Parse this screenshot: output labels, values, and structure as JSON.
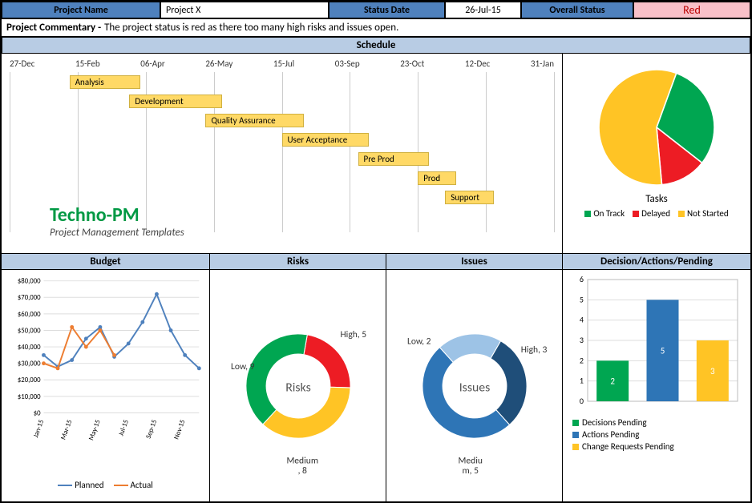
{
  "header": {
    "project_name_label": "Project Name",
    "project_name_value": "Project X",
    "status_date_label": "Status Date",
    "status_date_value": "26-Jul-15",
    "overall_status_label": "Overall Status",
    "overall_status_value": "Red"
  },
  "commentary": {
    "label": "Project Commentary -",
    "text": "The project status is red as there too many high risks and issues open."
  },
  "schedule": {
    "title": "Schedule",
    "axis": [
      "27-Dec",
      "15-Feb",
      "06-Apr",
      "26-May",
      "15-Jul",
      "03-Sep",
      "23-Oct",
      "12-Dec",
      "31-Jan"
    ],
    "bars": [
      {
        "label": "Analysis",
        "left_pct": 11,
        "width_pct": 13,
        "row": 0
      },
      {
        "label": "Development",
        "left_pct": 22,
        "width_pct": 17,
        "row": 1
      },
      {
        "label": "Quality Assurance",
        "left_pct": 36,
        "width_pct": 18,
        "row": 2
      },
      {
        "label": "User Acceptance",
        "left_pct": 50,
        "width_pct": 16,
        "row": 3
      },
      {
        "label": "Pre Prod",
        "left_pct": 64,
        "width_pct": 13,
        "row": 4
      },
      {
        "label": "Prod",
        "left_pct": 75,
        "width_pct": 7,
        "row": 5
      },
      {
        "label": "Support",
        "left_pct": 80,
        "width_pct": 9,
        "row": 6
      }
    ],
    "watermark": {
      "line1": "Techno-PM",
      "line2": "Project Management Templates"
    }
  },
  "tasks_pie": {
    "title": "Tasks",
    "legend": [
      "On Track",
      "Delayed",
      "Not Started"
    ]
  },
  "panels": {
    "budget": "Budget",
    "risks": "Risks",
    "issues": "Issues",
    "dap": "Decision/Actions/Pending"
  },
  "budget_legend": {
    "planned": "Planned",
    "actual": "Actual"
  },
  "risks_labels": {
    "center": "Risks",
    "high": "High, 5",
    "medium": "Medium , 8",
    "low": "Low, 9"
  },
  "issues_labels": {
    "center": "Issues",
    "high": "High, 3",
    "medium": "Medium, 5",
    "low": "Low, 2"
  },
  "dap_legend": {
    "decisions": "Decisions Pending",
    "actions": "Actions Pending",
    "change": "Change Requests Pending"
  },
  "chart_data": [
    {
      "type": "pie",
      "title": "Tasks",
      "series": [
        {
          "name": "On Track",
          "value": 30,
          "color": "#00a651"
        },
        {
          "name": "Delayed",
          "value": 13,
          "color": "#ed1c24"
        },
        {
          "name": "Not Started",
          "value": 57,
          "color": "#ffc425"
        }
      ]
    },
    {
      "type": "line",
      "title": "Budget",
      "ylabel": "",
      "xlabel": "",
      "ylim": [
        0,
        80000
      ],
      "yticks": [
        "$0",
        "$10,000",
        "$20,000",
        "$30,000",
        "$40,000",
        "$50,000",
        "$60,000",
        "$70,000",
        "$80,000"
      ],
      "categories": [
        "Jan-15",
        "Feb-15",
        "Mar-15",
        "Apr-15",
        "May-15",
        "Jun-15",
        "Jul-15",
        "Aug-15",
        "Sep-15",
        "Oct-15",
        "Nov-15",
        "Dec-15"
      ],
      "xtick_labels": [
        "Jan-15",
        "Mar-15",
        "May-15",
        "Jul-15",
        "Sep-15",
        "Nov-15"
      ],
      "series": [
        {
          "name": "Planned",
          "color": "#4f81bd",
          "values": [
            35000,
            28000,
            32000,
            45000,
            52000,
            34000,
            42000,
            55000,
            72000,
            50000,
            35000,
            27000
          ]
        },
        {
          "name": "Actual",
          "color": "#ed7d31",
          "values": [
            30000,
            27000,
            52000,
            40000,
            50000,
            35000,
            null,
            null,
            null,
            null,
            null,
            null
          ]
        }
      ]
    },
    {
      "type": "pie",
      "title": "Risks",
      "donut": true,
      "series": [
        {
          "name": "High",
          "value": 5,
          "color": "#ed1c24"
        },
        {
          "name": "Medium",
          "value": 8,
          "color": "#ffc425"
        },
        {
          "name": "Low",
          "value": 9,
          "color": "#00a651"
        }
      ]
    },
    {
      "type": "pie",
      "title": "Issues",
      "donut": true,
      "series": [
        {
          "name": "High",
          "value": 3,
          "color": "#1f4e79"
        },
        {
          "name": "Medium",
          "value": 5,
          "color": "#2e75b6"
        },
        {
          "name": "Low",
          "value": 2,
          "color": "#9dc3e6"
        }
      ]
    },
    {
      "type": "bar",
      "title": "Decision/Actions/Pending",
      "ylim": [
        0,
        6
      ],
      "categories": [
        "Decisions Pending",
        "Actions Pending",
        "Change Requests Pending"
      ],
      "values": [
        2,
        5,
        3
      ],
      "colors": [
        "#00a651",
        "#2e75b6",
        "#ffc425"
      ]
    }
  ]
}
